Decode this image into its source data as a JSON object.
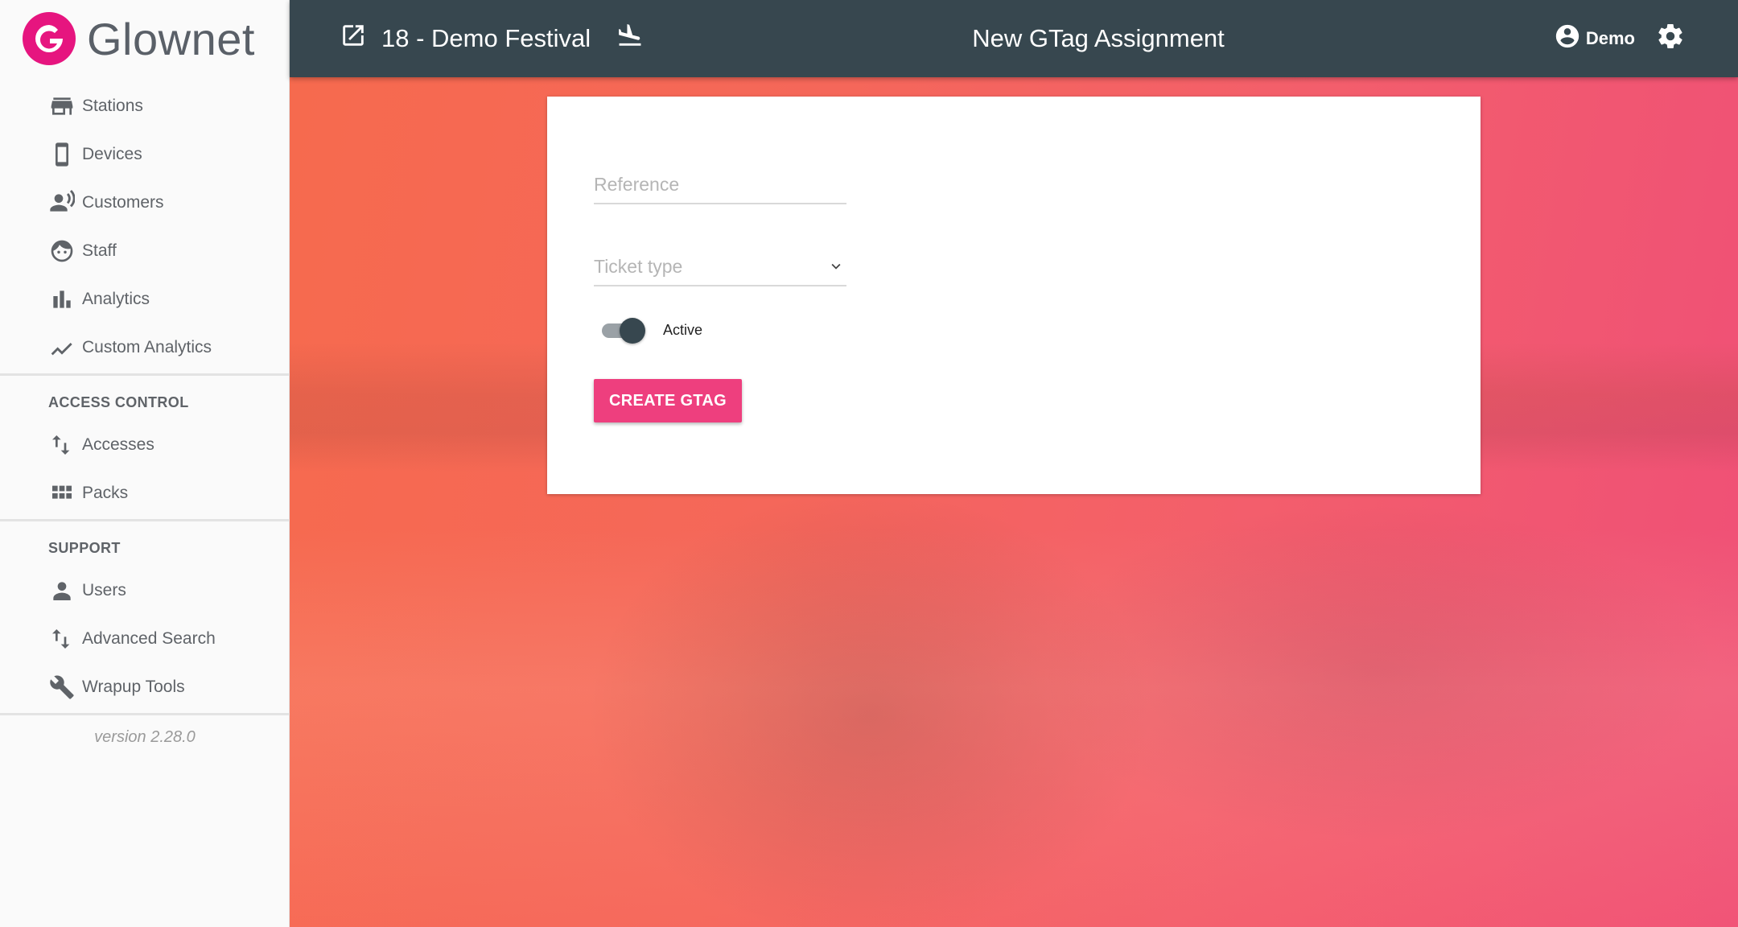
{
  "brand": {
    "name": "Glownet",
    "logo_letter": "G",
    "color": "#e6157f"
  },
  "sidebar": {
    "items": [
      {
        "label": "Stations",
        "icon": "store-icon"
      },
      {
        "label": "Devices",
        "icon": "phone-icon"
      },
      {
        "label": "Customers",
        "icon": "customer-voice-icon"
      },
      {
        "label": "Staff",
        "icon": "face-icon"
      },
      {
        "label": "Analytics",
        "icon": "bar-chart-icon"
      },
      {
        "label": "Custom Analytics",
        "icon": "line-chart-icon"
      }
    ],
    "access_control": {
      "title": "ACCESS CONTROL",
      "items": [
        {
          "label": "Accesses",
          "icon": "swap-vertical-icon"
        },
        {
          "label": "Packs",
          "icon": "grid-icon"
        }
      ]
    },
    "support": {
      "title": "SUPPORT",
      "items": [
        {
          "label": "Users",
          "icon": "person-icon"
        },
        {
          "label": "Advanced Search",
          "icon": "swap-vertical-icon"
        },
        {
          "label": "Wrapup Tools",
          "icon": "wrench-icon"
        }
      ]
    },
    "version": "version 2.28.0"
  },
  "topbar": {
    "event_name": "18 - Demo Festival",
    "page_title": "New GTag Assignment",
    "user_name": "Demo",
    "background": "#37474f"
  },
  "form": {
    "reference_placeholder": "Reference",
    "ticket_type_placeholder": "Ticket type",
    "active_label": "Active",
    "active": true,
    "submit_label": "CREATE GTAG",
    "accent": "#ee3f7e"
  }
}
